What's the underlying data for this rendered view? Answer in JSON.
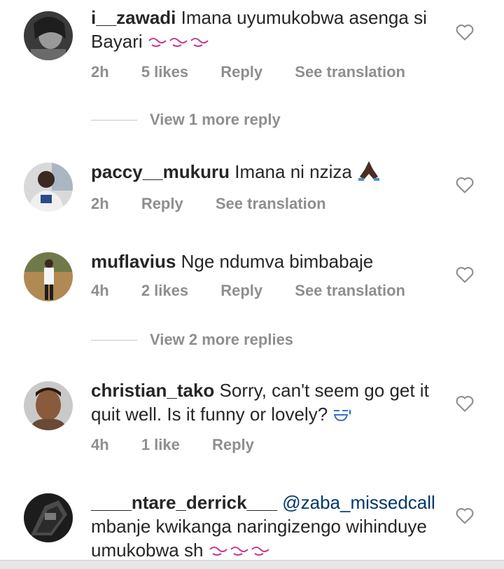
{
  "comments": [
    {
      "username": "i__zawadi",
      "text": "Imana uyumukobwa asenga si Bayari",
      "emoji": "crying-laughing-emoji x3",
      "time": "2h",
      "likes": "5 likes",
      "reply": "Reply",
      "translation": "See translation",
      "view_more": "View 1 more reply"
    },
    {
      "username": "paccy__mukuru",
      "text": "Imana ni nziza",
      "emoji": "praying-hands-emoji",
      "time": "2h",
      "reply": "Reply",
      "translation": "See translation"
    },
    {
      "username": "muflavius",
      "text": "Nge ndumva bimbabaje",
      "time": "4h",
      "likes": "2 likes",
      "reply": "Reply",
      "translation": "See translation",
      "view_more": "View 2 more replies"
    },
    {
      "username": "christian_tako",
      "text": "Sorry, can't seem go get it quit well. Is it funny or lovely?",
      "emoji": "sweat-smile-emoji",
      "time": "4h",
      "likes": "1 like",
      "reply": "Reply"
    },
    {
      "username": "____ntare_derrick___",
      "mention": "@zaba_missedcall",
      "text": "mbanje kwikanga naringizengo wihinduye umukobwa sh",
      "emoji": "crying-laughing-emoji x3"
    }
  ],
  "icons": {
    "like": "heart-outline-icon"
  },
  "colors": {
    "username": "#262626",
    "meta": "#8e8e8e",
    "mention": "#00376b",
    "divider": "#c7c7c7"
  }
}
